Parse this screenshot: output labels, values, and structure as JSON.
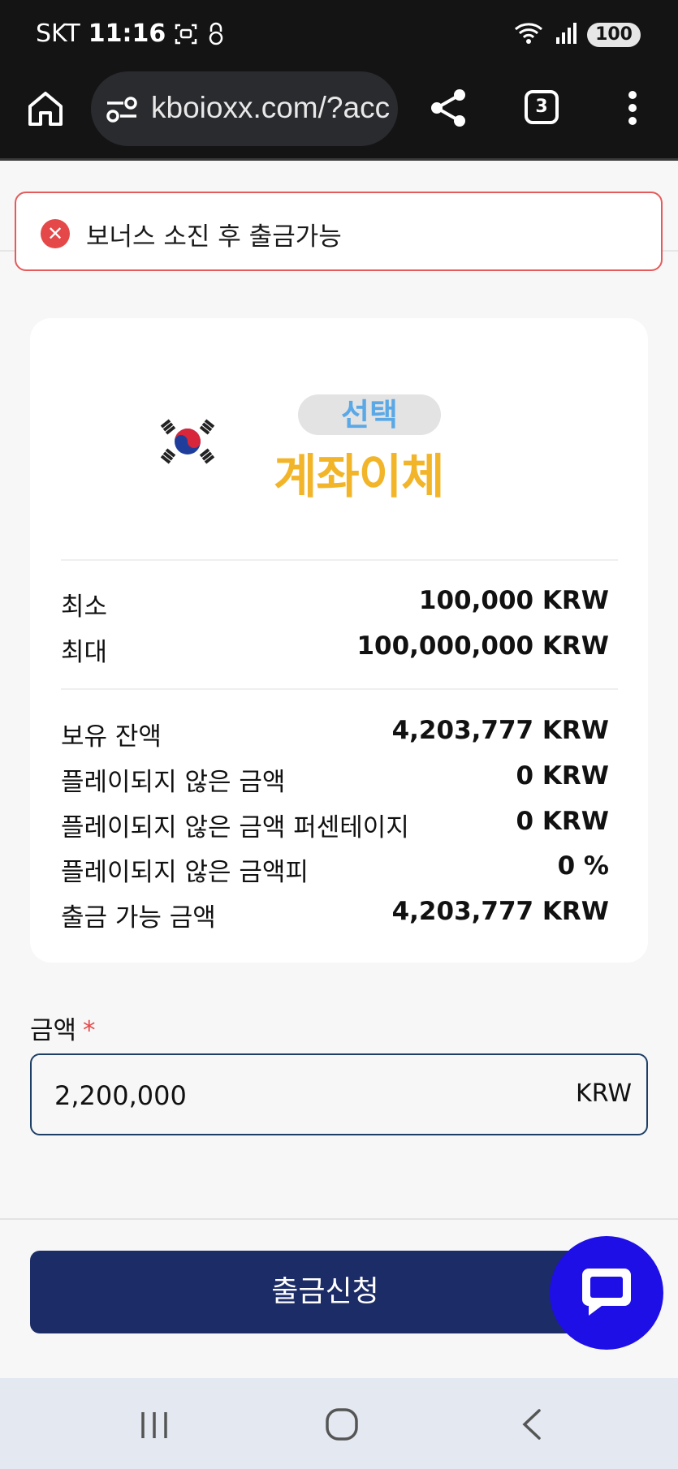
{
  "status_bar": {
    "carrier": "SKT",
    "time": "11:16",
    "battery": "100"
  },
  "browser": {
    "url": "kboioxx.com/?acc",
    "tab_count": "3"
  },
  "alert": {
    "text": "보너스 소진 후 출금가능"
  },
  "method": {
    "badge": "선택",
    "title": "계좌이체"
  },
  "limits": [
    {
      "label": "최소",
      "value": "100,000 KRW"
    },
    {
      "label": "최대",
      "value": "100,000,000 KRW"
    }
  ],
  "balances": [
    {
      "label": "보유 잔액",
      "value": "4,203,777 KRW"
    },
    {
      "label": "플레이되지 않은 금액",
      "value": "0 KRW"
    },
    {
      "label": "플레이되지 않은 금액 퍼센테이지",
      "value": "0 KRW"
    },
    {
      "label": "플레이되지 않은 금액피",
      "value": "0 %"
    },
    {
      "label": "출금 가능 금액",
      "value": "4,203,777 KRW"
    }
  ],
  "amount": {
    "label": "금액",
    "required_mark": "*",
    "value": "2,200,000",
    "unit": "KRW"
  },
  "submit_label": "출금신청",
  "colors": {
    "submit": "#1c2c66",
    "chat": "#1e0fe6",
    "alert_border": "#e55a5a",
    "method_title": "#f2b52a"
  }
}
